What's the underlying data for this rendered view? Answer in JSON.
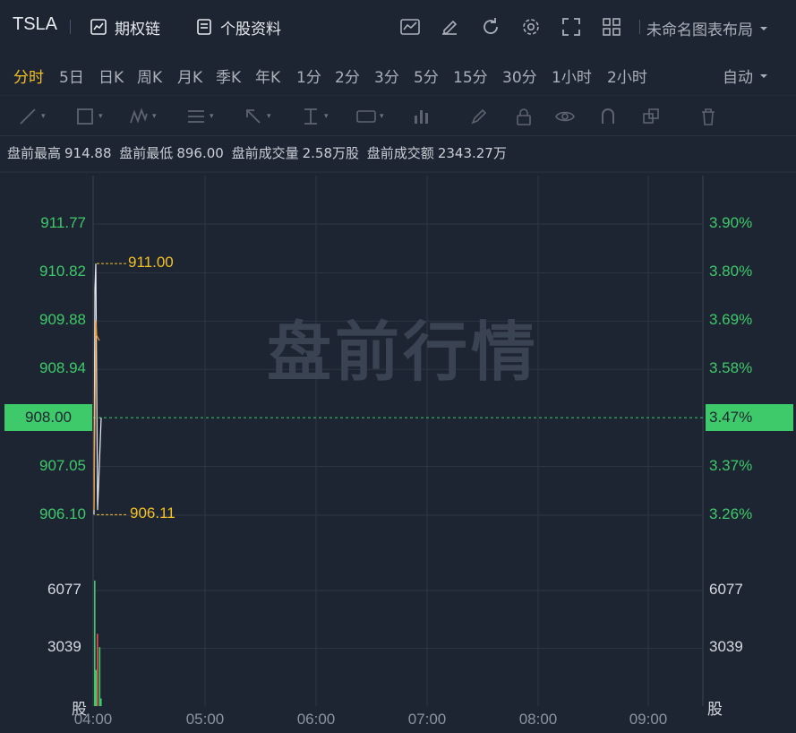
{
  "header": {
    "ticker": "TSLA",
    "options_chain": "期权链",
    "stock_info": "个股资料",
    "layout_name": "未命名图表布局"
  },
  "intervals": {
    "items": [
      "分时",
      "5日",
      "日K",
      "周K",
      "月K",
      "季K",
      "年K",
      "1分",
      "2分",
      "3分",
      "5分",
      "15分",
      "30分",
      "1小时",
      "2小时"
    ],
    "active": "分时",
    "mode": "自动"
  },
  "premarket": {
    "high_label": "盘前最高",
    "high_value": "914.88",
    "low_label": "盘前最低",
    "low_value": "896.00",
    "volume_label": "盘前成交量",
    "volume_value": "2.58万股",
    "turnover_label": "盘前成交额",
    "turnover_value": "2343.27万"
  },
  "chart": {
    "watermark": "盘前行情",
    "price_ticks": [
      "911.77",
      "910.82",
      "909.88",
      "908.94",
      "908.00",
      "907.05",
      "906.10"
    ],
    "pct_ticks": [
      "3.90%",
      "3.80%",
      "3.69%",
      "3.58%",
      "3.47%",
      "3.37%",
      "3.26%"
    ],
    "current_price": "908.00",
    "current_pct": "3.47%",
    "high_marker": "911.00",
    "low_marker": "906.11",
    "volume_ticks": [
      "6077",
      "3039"
    ],
    "volume_unit": "股",
    "time_ticks": [
      "04:00",
      "05:00",
      "06:00",
      "07:00",
      "08:00",
      "09:00"
    ],
    "colors": {
      "up": "#3ec96a",
      "down": "#e84a4a",
      "marker": "#f3c024",
      "price_line": "#e8ecf2",
      "avg_line": "#f39a2c"
    }
  },
  "chart_data": {
    "type": "line",
    "x": [
      "04:00",
      "04:01",
      "04:02",
      "04:03",
      "04:04"
    ],
    "series": [
      {
        "values": [
          906.11,
          910.5,
          911.0,
          906.2,
          908.0
        ]
      }
    ],
    "volume": [
      6600,
      3800,
      1900,
      3100,
      400
    ],
    "ylim": [
      906.1,
      911.77
    ]
  }
}
